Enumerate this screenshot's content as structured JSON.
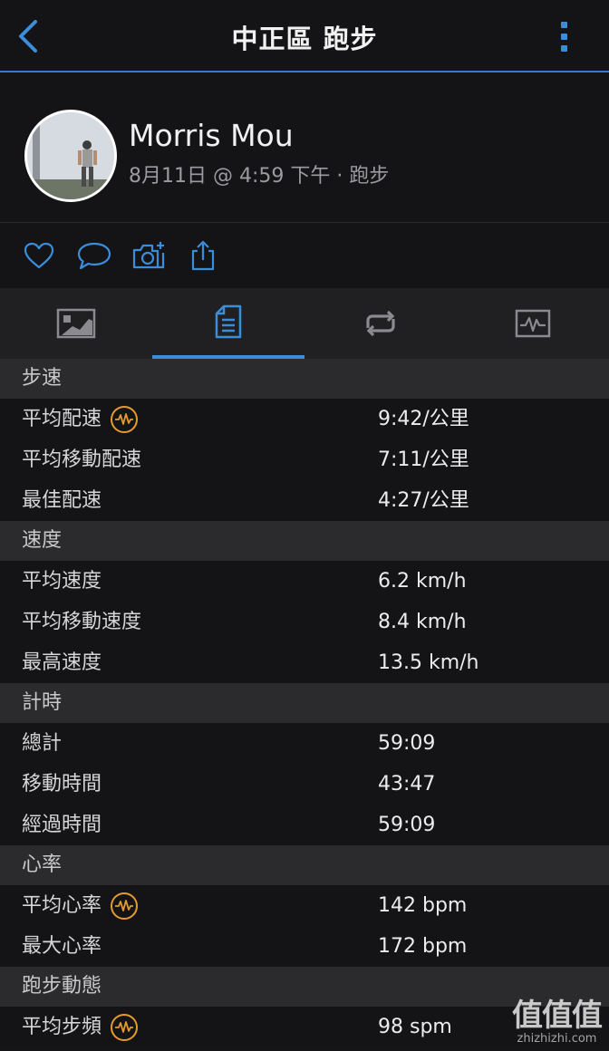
{
  "header": {
    "title": "中正區 跑步",
    "back_icon": "chevron-left-icon",
    "more_icon": "more-vertical-icon",
    "accent": "#3a8ddb"
  },
  "profile": {
    "name": "Morris Mou",
    "meta": "8月11日 @ 4:59 下午 · 跑步"
  },
  "actions": [
    {
      "name": "like",
      "icon": "heart-icon"
    },
    {
      "name": "comment",
      "icon": "comment-icon"
    },
    {
      "name": "add-photo",
      "icon": "camera-plus-icon"
    },
    {
      "name": "share",
      "icon": "share-icon"
    }
  ],
  "tabs": [
    {
      "name": "map",
      "icon": "map-icon",
      "active": false
    },
    {
      "name": "stats",
      "icon": "stats-list-icon",
      "active": true
    },
    {
      "name": "laps",
      "icon": "laps-icon",
      "active": false
    },
    {
      "name": "charts",
      "icon": "chart-icon",
      "active": false
    }
  ],
  "sections": [
    {
      "title": "步速",
      "rows": [
        {
          "label": "平均配速",
          "value": "9:42/公里",
          "badge": true
        },
        {
          "label": "平均移動配速",
          "value": "7:11/公里",
          "badge": false
        },
        {
          "label": "最佳配速",
          "value": "4:27/公里",
          "badge": false
        }
      ]
    },
    {
      "title": "速度",
      "rows": [
        {
          "label": "平均速度",
          "value": "6.2 km/h",
          "badge": false
        },
        {
          "label": "平均移動速度",
          "value": "8.4 km/h",
          "badge": false
        },
        {
          "label": "最高速度",
          "value": "13.5 km/h",
          "badge": false
        }
      ]
    },
    {
      "title": "計時",
      "rows": [
        {
          "label": "總計",
          "value": "59:09",
          "badge": false
        },
        {
          "label": "移動時間",
          "value": "43:47",
          "badge": false
        },
        {
          "label": "經過時間",
          "value": "59:09",
          "badge": false
        }
      ]
    },
    {
      "title": "心率",
      "rows": [
        {
          "label": "平均心率",
          "value": "142 bpm",
          "badge": true
        },
        {
          "label": "最大心率",
          "value": "172 bpm",
          "badge": false
        }
      ]
    },
    {
      "title": "跑步動態",
      "rows": [
        {
          "label": "平均步頻",
          "value": "98 spm",
          "badge": true
        }
      ]
    }
  ],
  "watermark": {
    "logo": "值值值",
    "url": "zhizhizhi.com"
  }
}
